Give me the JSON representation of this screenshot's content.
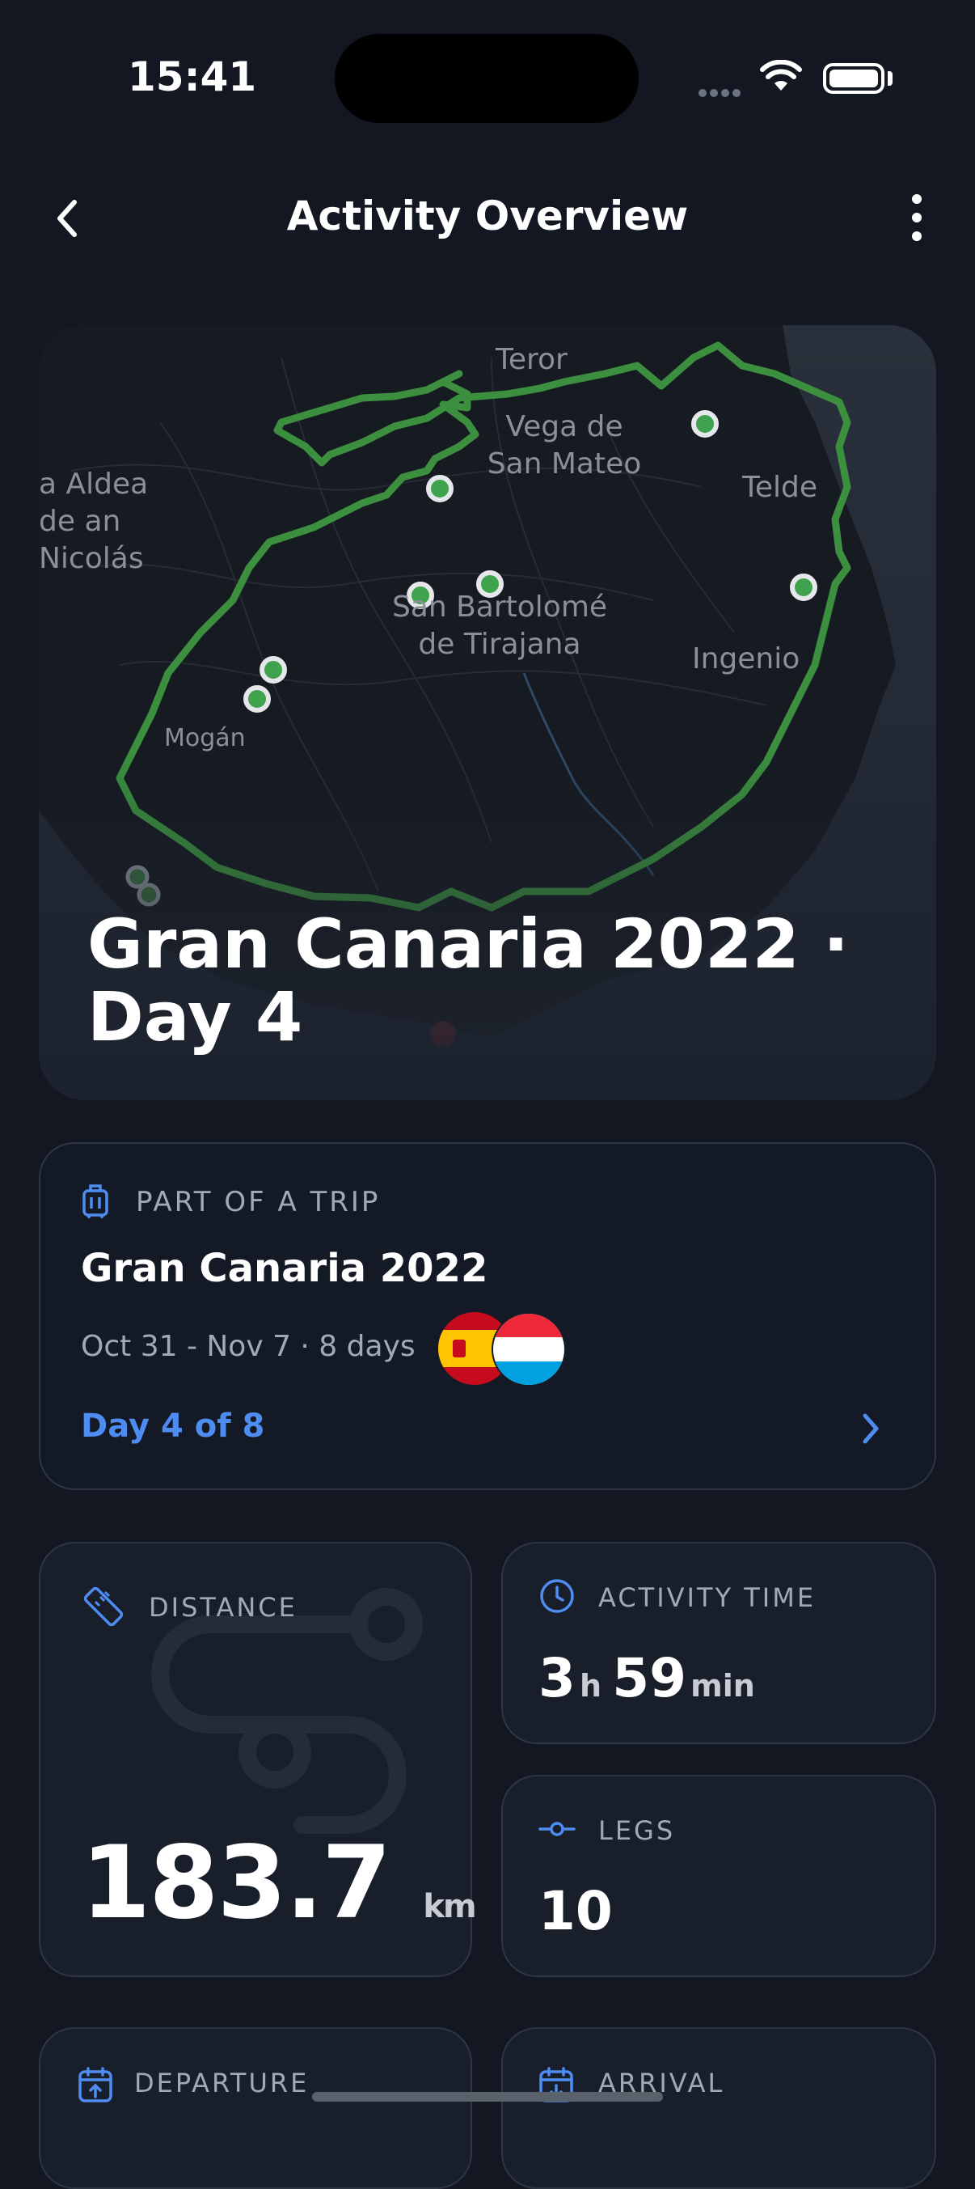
{
  "status_bar": {
    "time": "15:41"
  },
  "header": {
    "title": "Activity Overview"
  },
  "map": {
    "title": "Gran Canaria 2022 · Day 4",
    "places": {
      "teror": "Teror",
      "vega": "Vega de San Mateo",
      "telde": "Telde",
      "aldea": "a Aldea de an Nicolás",
      "sanbartolome": "San Bartolomé de Tirajana",
      "ingenio": "Ingenio",
      "mogan": "Mogán"
    },
    "route_color": "#3b8f3e",
    "marker_color": "#3fa34d"
  },
  "trip": {
    "label": "PART OF A TRIP",
    "name": "Gran Canaria 2022",
    "dates": "Oct 31 - Nov 7 · 8 days",
    "day": "Day 4 of 8",
    "flags": [
      "spain-flag",
      "luxembourg-flag"
    ]
  },
  "stats": {
    "distance": {
      "label": "DISTANCE",
      "value": "183.7",
      "unit": "km"
    },
    "activity_time": {
      "label": "ACTIVITY TIME",
      "hours": "3",
      "h_unit": "h",
      "minutes": "59",
      "min_unit": "min"
    },
    "legs": {
      "label": "LEGS",
      "value": "10"
    },
    "departure": {
      "label": "DEPARTURE"
    },
    "arrival": {
      "label": "ARRIVAL"
    }
  },
  "accent_color": "#4e8cf2"
}
